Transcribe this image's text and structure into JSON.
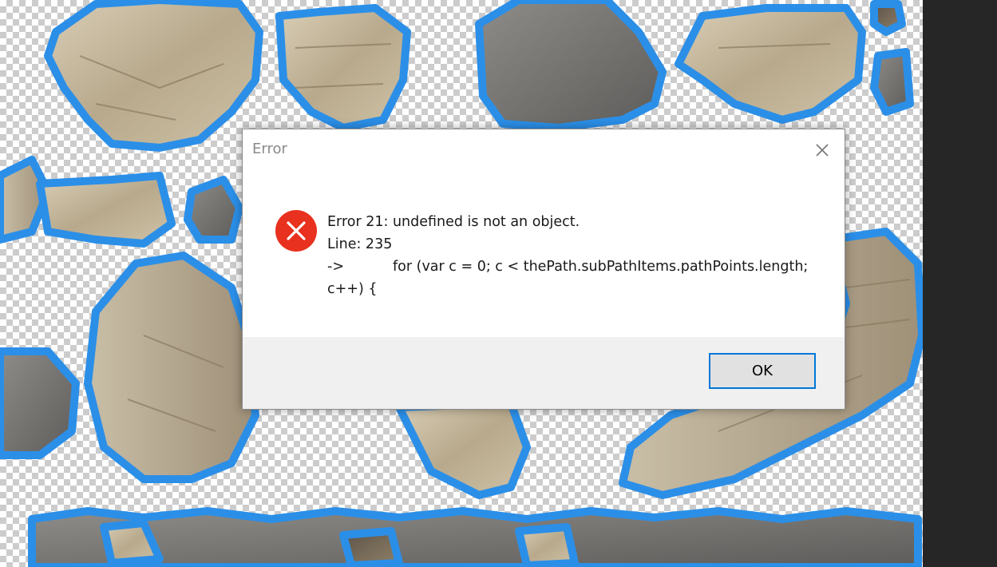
{
  "dialog": {
    "title": "Error",
    "message_line1": "Error 21: undefined is not an object.",
    "message_line2": "Line: 235",
    "message_line3_arrow": "->",
    "message_line3_code": "for (var c = 0; c < thePath.subPathItems.pathPoints.length;",
    "message_line4": "c++) {",
    "ok_label": "OK",
    "icon": "error-icon",
    "close_icon": "close-icon"
  },
  "colors": {
    "selection_outline": "#2b8fe8",
    "error_red": "#e8311e",
    "ok_border": "#0078d7",
    "panel_dark": "#262626"
  }
}
